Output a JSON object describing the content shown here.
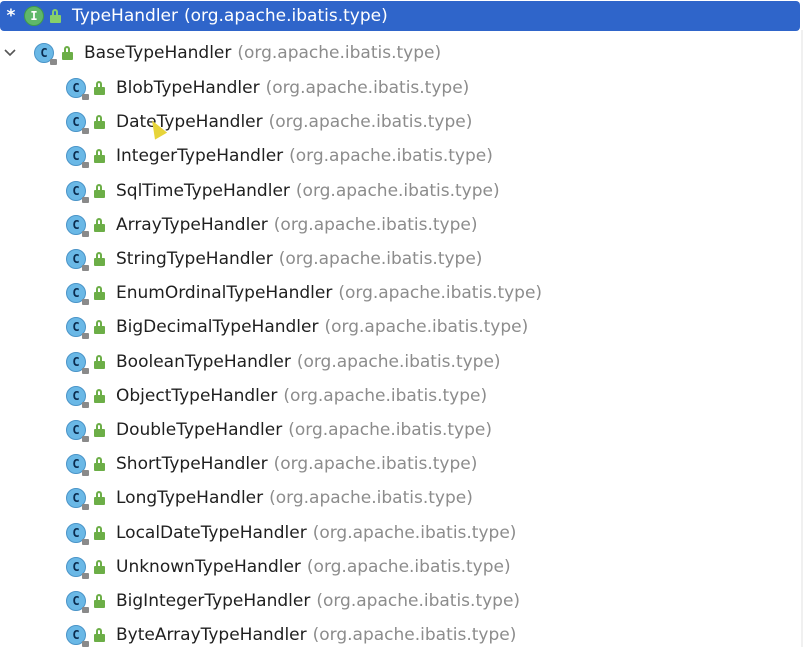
{
  "root": {
    "marker": "*",
    "icon_letter": "I",
    "name": "TypeHandler",
    "package": "(org.apache.ibatis.type)"
  },
  "base": {
    "expand_glyph": "⌄",
    "icon_letter": "C",
    "name": "BaseTypeHandler",
    "package": "(org.apache.ibatis.type)"
  },
  "items": [
    {
      "name": "BlobTypeHandler",
      "package": "(org.apache.ibatis.type)"
    },
    {
      "name": "DateTypeHandler",
      "package": "(org.apache.ibatis.type)"
    },
    {
      "name": "IntegerTypeHandler",
      "package": "(org.apache.ibatis.type)"
    },
    {
      "name": "SqlTimeTypeHandler",
      "package": "(org.apache.ibatis.type)"
    },
    {
      "name": "ArrayTypeHandler",
      "package": "(org.apache.ibatis.type)"
    },
    {
      "name": "StringTypeHandler",
      "package": "(org.apache.ibatis.type)"
    },
    {
      "name": "EnumOrdinalTypeHandler",
      "package": "(org.apache.ibatis.type)"
    },
    {
      "name": "BigDecimalTypeHandler",
      "package": "(org.apache.ibatis.type)"
    },
    {
      "name": "BooleanTypeHandler",
      "package": "(org.apache.ibatis.type)"
    },
    {
      "name": "ObjectTypeHandler",
      "package": "(org.apache.ibatis.type)"
    },
    {
      "name": "DoubleTypeHandler",
      "package": "(org.apache.ibatis.type)"
    },
    {
      "name": "ShortTypeHandler",
      "package": "(org.apache.ibatis.type)"
    },
    {
      "name": "LongTypeHandler",
      "package": "(org.apache.ibatis.type)"
    },
    {
      "name": "LocalDateTypeHandler",
      "package": "(org.apache.ibatis.type)"
    },
    {
      "name": "UnknownTypeHandler",
      "package": "(org.apache.ibatis.type)"
    },
    {
      "name": "BigIntegerTypeHandler",
      "package": "(org.apache.ibatis.type)"
    },
    {
      "name": "ByteArrayTypeHandler",
      "package": "(org.apache.ibatis.type)"
    }
  ],
  "item_icon_letter": "C",
  "icons": {
    "interface": "interface-icon",
    "class": "class-icon",
    "visibility": "public-visibility-icon",
    "expand": "chevron-down-icon"
  },
  "colors": {
    "selection": "#2f65ca",
    "package_text": "#8c8c8c",
    "class_icon": "#6ab8e6",
    "interface_icon": "#5fb86a",
    "visibility": "#6cae47"
  }
}
